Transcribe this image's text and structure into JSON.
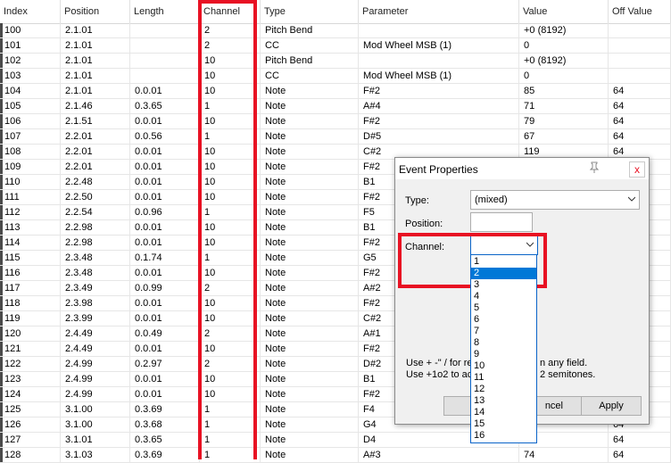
{
  "columns": [
    "Index",
    "Position",
    "Length",
    "Channel",
    "Type",
    "Parameter",
    "Value",
    "Off Value"
  ],
  "rows": [
    [
      "100",
      "2.1.01",
      "",
      "2",
      "Pitch Bend",
      "",
      "+0 (8192)",
      ""
    ],
    [
      "101",
      "2.1.01",
      "",
      "2",
      "CC",
      "Mod Wheel MSB (1)",
      "0",
      ""
    ],
    [
      "102",
      "2.1.01",
      "",
      "10",
      "Pitch Bend",
      "",
      "+0 (8192)",
      ""
    ],
    [
      "103",
      "2.1.01",
      "",
      "10",
      "CC",
      "Mod Wheel MSB (1)",
      "0",
      ""
    ],
    [
      "104",
      "2.1.01",
      "0.0.01",
      "10",
      "Note",
      "F#2",
      "85",
      "64"
    ],
    [
      "105",
      "2.1.46",
      "0.3.65",
      "1",
      "Note",
      "A#4",
      "71",
      "64"
    ],
    [
      "106",
      "2.1.51",
      "0.0.01",
      "10",
      "Note",
      "F#2",
      "79",
      "64"
    ],
    [
      "107",
      "2.2.01",
      "0.0.56",
      "1",
      "Note",
      "D#5",
      "67",
      "64"
    ],
    [
      "108",
      "2.2.01",
      "0.0.01",
      "10",
      "Note",
      "C#2",
      "119",
      "64"
    ],
    [
      "109",
      "2.2.01",
      "0.0.01",
      "10",
      "Note",
      "F#2",
      "",
      ""
    ],
    [
      "110",
      "2.2.48",
      "0.0.01",
      "10",
      "Note",
      "B1",
      "",
      ""
    ],
    [
      "111",
      "2.2.50",
      "0.0.01",
      "10",
      "Note",
      "F#2",
      "",
      ""
    ],
    [
      "112",
      "2.2.54",
      "0.0.96",
      "1",
      "Note",
      "F5",
      "",
      ""
    ],
    [
      "113",
      "2.2.98",
      "0.0.01",
      "10",
      "Note",
      "B1",
      "",
      ""
    ],
    [
      "114",
      "2.2.98",
      "0.0.01",
      "10",
      "Note",
      "F#2",
      "",
      ""
    ],
    [
      "115",
      "2.3.48",
      "0.1.74",
      "1",
      "Note",
      "G5",
      "",
      ""
    ],
    [
      "116",
      "2.3.48",
      "0.0.01",
      "10",
      "Note",
      "F#2",
      "",
      ""
    ],
    [
      "117",
      "2.3.49",
      "0.0.99",
      "2",
      "Note",
      "A#2",
      "",
      ""
    ],
    [
      "118",
      "2.3.98",
      "0.0.01",
      "10",
      "Note",
      "F#2",
      "",
      ""
    ],
    [
      "119",
      "2.3.99",
      "0.0.01",
      "10",
      "Note",
      "C#2",
      "",
      ""
    ],
    [
      "120",
      "2.4.49",
      "0.0.49",
      "2",
      "Note",
      "A#1",
      "",
      ""
    ],
    [
      "121",
      "2.4.49",
      "0.0.01",
      "10",
      "Note",
      "F#2",
      "",
      ""
    ],
    [
      "122",
      "2.4.99",
      "0.2.97",
      "2",
      "Note",
      "D#2",
      "",
      ""
    ],
    [
      "123",
      "2.4.99",
      "0.0.01",
      "10",
      "Note",
      "B1",
      "",
      ""
    ],
    [
      "124",
      "2.4.99",
      "0.0.01",
      "10",
      "Note",
      "F#2",
      "",
      ""
    ],
    [
      "125",
      "3.1.00",
      "0.3.69",
      "1",
      "Note",
      "F4",
      "",
      ""
    ],
    [
      "126",
      "3.1.00",
      "0.3.68",
      "1",
      "Note",
      "G4",
      "",
      "64"
    ],
    [
      "127",
      "3.1.01",
      "0.3.65",
      "1",
      "Note",
      "D4",
      "",
      "64"
    ],
    [
      "128",
      "3.1.03",
      "0.3.69",
      "1",
      "Note",
      "A#3",
      "74",
      "64"
    ]
  ],
  "dialog": {
    "title": "Event Properties",
    "type_label": "Type:",
    "type_value": "(mixed)",
    "position_label": "Position:",
    "position_value": "",
    "channel_label": "Channel:",
    "channel_value": "",
    "channel_options": [
      "1",
      "2",
      "3",
      "4",
      "5",
      "6",
      "7",
      "8",
      "9",
      "10",
      "11",
      "12",
      "13",
      "14",
      "15",
      "16"
    ],
    "channel_selected": "2",
    "hint_line1_a": "Use + -\" / for re",
    "hint_line1_b": "n any field.",
    "hint_line2_a": "Use +1o2  to ac",
    "hint_line2_b": "2 semitones.",
    "ok_label": "O",
    "cancel_label": "ncel",
    "apply_label": "Apply",
    "close_glyph": "x",
    "pin_icon": "pin-icon"
  },
  "colors": {
    "highlight": "#e81123",
    "selection": "#0078d7"
  }
}
